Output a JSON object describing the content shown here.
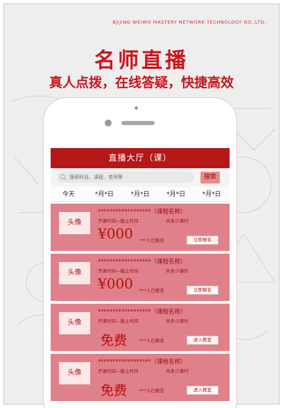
{
  "company": "BJIJING WEIWO MASTERY NETWORK TECHNOLOGY GO.,LTD.",
  "headline": "名师直播",
  "tagline": "真人点拨，在线答疑，快捷高效",
  "app": {
    "title": "直播大厅（课）",
    "search": {
      "placeholder": "搜索科目、课程、老师等",
      "button": "搜索"
    },
    "date_tabs": [
      "今天",
      "*月*日",
      "*月*日",
      "*月*日",
      "*月*日"
    ],
    "courses": [
      {
        "avatar": "头像",
        "title": "******************（课程名称）",
        "time": "开课时间—截止时间",
        "hours": "共多少课时",
        "price": "¥000",
        "enrolled": "***人已报名",
        "action": "立即报名"
      },
      {
        "avatar": "头像",
        "title": "******************（课程名称）",
        "time": "开课时间—截止时间",
        "hours": "共多少课时",
        "price": "¥000",
        "enrolled": "***人已报名",
        "action": "立即报名"
      },
      {
        "avatar": "头像",
        "title": "******************（课程名称）",
        "time": "开课时间—截止时间",
        "hours": "共多少课时",
        "price": "免费",
        "enrolled": "***人已报名",
        "action": "进入教室"
      },
      {
        "avatar": "头像",
        "title": "******************（课程名称）",
        "time": "开课时间—截止时间",
        "hours": "共多少课时",
        "price": "免费",
        "enrolled": "***人已报名",
        "action": "进入教室"
      }
    ]
  },
  "colors": {
    "brand_red": "#b41818",
    "card_pink": "#e0808a",
    "accent_red": "#c8161d"
  }
}
